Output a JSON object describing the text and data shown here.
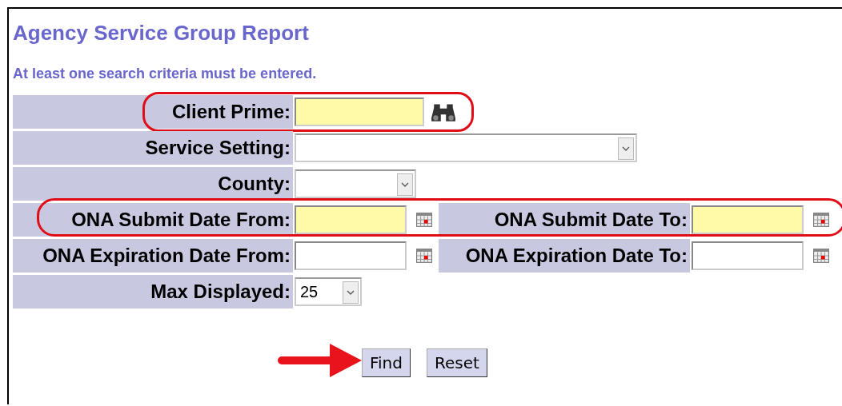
{
  "title": "Agency Service Group Report",
  "instruction": "At least one search criteria must be entered.",
  "rows": [
    {
      "kind": "lookup",
      "label": "Client Prime:",
      "highlighted": true,
      "circled": true
    },
    {
      "kind": "select",
      "label": "Service Setting:"
    },
    {
      "kind": "select",
      "label": "County:"
    },
    {
      "kind": "date-range",
      "from_label": "ONA Submit Date From:",
      "to_label": "ONA Submit Date To:",
      "highlighted": true,
      "circled": true
    },
    {
      "kind": "date-range",
      "from_label": "ONA Expiration Date From:",
      "to_label": "ONA Expiration Date To:",
      "highlighted": false
    },
    {
      "kind": "select",
      "label": "Max Displayed:",
      "value": "25"
    }
  ],
  "buttons": [
    {
      "label": "Find",
      "pointed": true
    },
    {
      "label": "Reset",
      "pointed": false
    }
  ]
}
